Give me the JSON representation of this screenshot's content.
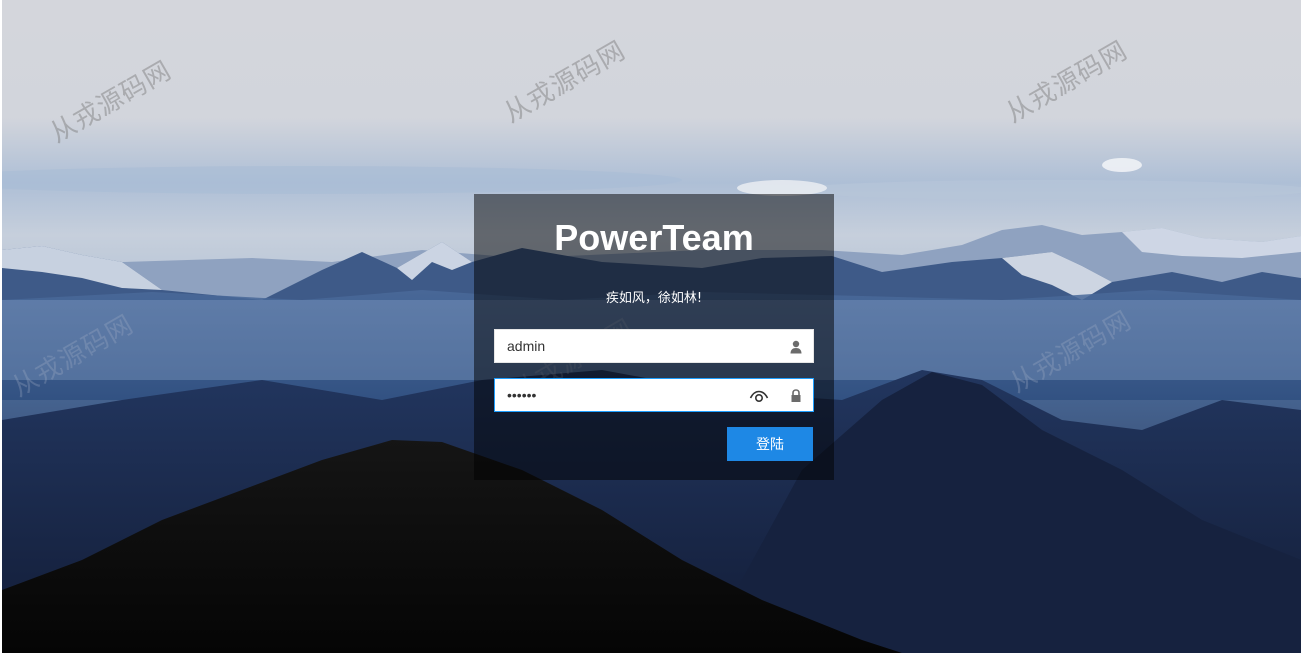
{
  "login": {
    "title": "PowerTeam",
    "slogan": "疾如风，徐如林!",
    "username_value": "admin",
    "password_mask": "••••••",
    "submit_label": "登陆"
  },
  "watermark": {
    "text": "从戎源码网"
  },
  "icons": {
    "username": "user-icon",
    "password": "lock-icon",
    "toggle_visibility": "eye-icon"
  },
  "colors": {
    "accent": "#1e88e5",
    "focus_border": "#1e9fff",
    "panel_overlay": "rgba(0,0,0,0.5)"
  }
}
